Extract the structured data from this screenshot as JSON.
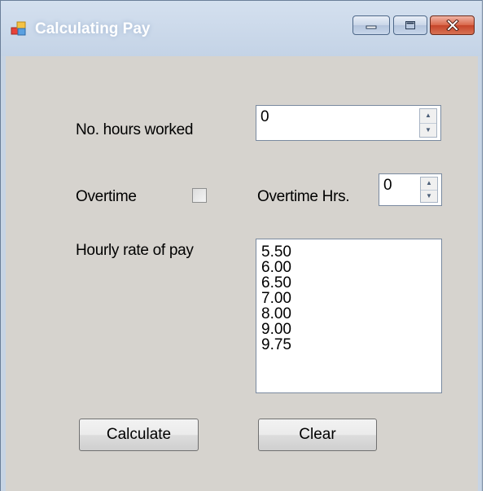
{
  "window": {
    "title": "Calculating Pay",
    "icon": "app-form-icon",
    "controls": {
      "minimize": "minimize-icon",
      "maximize": "maximize-icon",
      "close": "close-icon"
    }
  },
  "form": {
    "hours_label": "No. hours worked",
    "hours_value": "0",
    "overtime_label": "Overtime",
    "overtime_checked": false,
    "overtime_hrs_label": "Overtime Hrs.",
    "overtime_hrs_value": "0",
    "rate_label": "Hourly rate of pay",
    "rates": [
      "5.50",
      "6.00",
      "6.50",
      "7.00",
      "8.00",
      "9.00",
      "9.75"
    ],
    "calculate_label": "Calculate",
    "clear_label": "Clear"
  }
}
